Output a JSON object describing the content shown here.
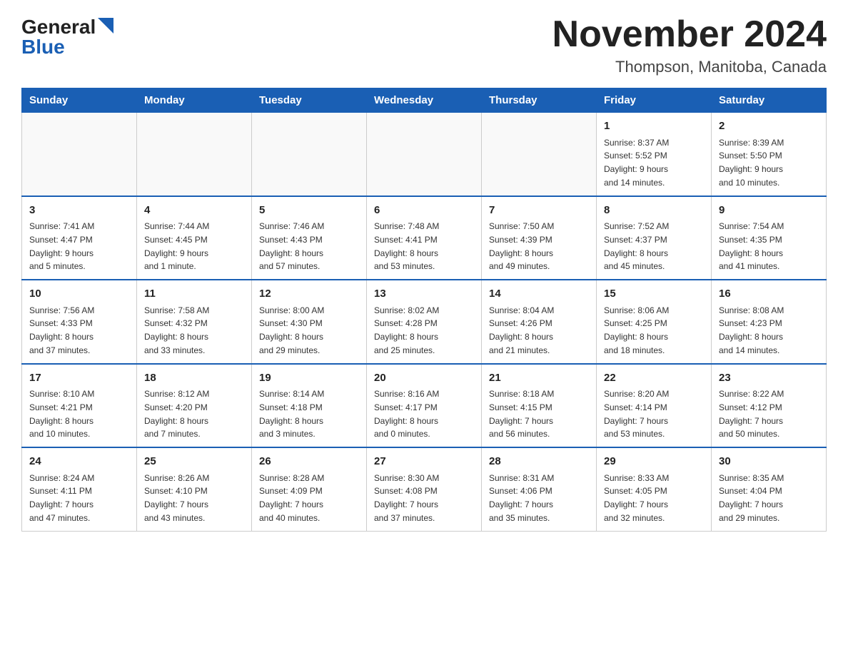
{
  "header": {
    "logo_general": "General",
    "logo_blue": "Blue",
    "title": "November 2024",
    "subtitle": "Thompson, Manitoba, Canada"
  },
  "days_of_week": [
    "Sunday",
    "Monday",
    "Tuesday",
    "Wednesday",
    "Thursday",
    "Friday",
    "Saturday"
  ],
  "weeks": [
    [
      {
        "day": "",
        "info": ""
      },
      {
        "day": "",
        "info": ""
      },
      {
        "day": "",
        "info": ""
      },
      {
        "day": "",
        "info": ""
      },
      {
        "day": "",
        "info": ""
      },
      {
        "day": "1",
        "info": "Sunrise: 8:37 AM\nSunset: 5:52 PM\nDaylight: 9 hours\nand 14 minutes."
      },
      {
        "day": "2",
        "info": "Sunrise: 8:39 AM\nSunset: 5:50 PM\nDaylight: 9 hours\nand 10 minutes."
      }
    ],
    [
      {
        "day": "3",
        "info": "Sunrise: 7:41 AM\nSunset: 4:47 PM\nDaylight: 9 hours\nand 5 minutes."
      },
      {
        "day": "4",
        "info": "Sunrise: 7:44 AM\nSunset: 4:45 PM\nDaylight: 9 hours\nand 1 minute."
      },
      {
        "day": "5",
        "info": "Sunrise: 7:46 AM\nSunset: 4:43 PM\nDaylight: 8 hours\nand 57 minutes."
      },
      {
        "day": "6",
        "info": "Sunrise: 7:48 AM\nSunset: 4:41 PM\nDaylight: 8 hours\nand 53 minutes."
      },
      {
        "day": "7",
        "info": "Sunrise: 7:50 AM\nSunset: 4:39 PM\nDaylight: 8 hours\nand 49 minutes."
      },
      {
        "day": "8",
        "info": "Sunrise: 7:52 AM\nSunset: 4:37 PM\nDaylight: 8 hours\nand 45 minutes."
      },
      {
        "day": "9",
        "info": "Sunrise: 7:54 AM\nSunset: 4:35 PM\nDaylight: 8 hours\nand 41 minutes."
      }
    ],
    [
      {
        "day": "10",
        "info": "Sunrise: 7:56 AM\nSunset: 4:33 PM\nDaylight: 8 hours\nand 37 minutes."
      },
      {
        "day": "11",
        "info": "Sunrise: 7:58 AM\nSunset: 4:32 PM\nDaylight: 8 hours\nand 33 minutes."
      },
      {
        "day": "12",
        "info": "Sunrise: 8:00 AM\nSunset: 4:30 PM\nDaylight: 8 hours\nand 29 minutes."
      },
      {
        "day": "13",
        "info": "Sunrise: 8:02 AM\nSunset: 4:28 PM\nDaylight: 8 hours\nand 25 minutes."
      },
      {
        "day": "14",
        "info": "Sunrise: 8:04 AM\nSunset: 4:26 PM\nDaylight: 8 hours\nand 21 minutes."
      },
      {
        "day": "15",
        "info": "Sunrise: 8:06 AM\nSunset: 4:25 PM\nDaylight: 8 hours\nand 18 minutes."
      },
      {
        "day": "16",
        "info": "Sunrise: 8:08 AM\nSunset: 4:23 PM\nDaylight: 8 hours\nand 14 minutes."
      }
    ],
    [
      {
        "day": "17",
        "info": "Sunrise: 8:10 AM\nSunset: 4:21 PM\nDaylight: 8 hours\nand 10 minutes."
      },
      {
        "day": "18",
        "info": "Sunrise: 8:12 AM\nSunset: 4:20 PM\nDaylight: 8 hours\nand 7 minutes."
      },
      {
        "day": "19",
        "info": "Sunrise: 8:14 AM\nSunset: 4:18 PM\nDaylight: 8 hours\nand 3 minutes."
      },
      {
        "day": "20",
        "info": "Sunrise: 8:16 AM\nSunset: 4:17 PM\nDaylight: 8 hours\nand 0 minutes."
      },
      {
        "day": "21",
        "info": "Sunrise: 8:18 AM\nSunset: 4:15 PM\nDaylight: 7 hours\nand 56 minutes."
      },
      {
        "day": "22",
        "info": "Sunrise: 8:20 AM\nSunset: 4:14 PM\nDaylight: 7 hours\nand 53 minutes."
      },
      {
        "day": "23",
        "info": "Sunrise: 8:22 AM\nSunset: 4:12 PM\nDaylight: 7 hours\nand 50 minutes."
      }
    ],
    [
      {
        "day": "24",
        "info": "Sunrise: 8:24 AM\nSunset: 4:11 PM\nDaylight: 7 hours\nand 47 minutes."
      },
      {
        "day": "25",
        "info": "Sunrise: 8:26 AM\nSunset: 4:10 PM\nDaylight: 7 hours\nand 43 minutes."
      },
      {
        "day": "26",
        "info": "Sunrise: 8:28 AM\nSunset: 4:09 PM\nDaylight: 7 hours\nand 40 minutes."
      },
      {
        "day": "27",
        "info": "Sunrise: 8:30 AM\nSunset: 4:08 PM\nDaylight: 7 hours\nand 37 minutes."
      },
      {
        "day": "28",
        "info": "Sunrise: 8:31 AM\nSunset: 4:06 PM\nDaylight: 7 hours\nand 35 minutes."
      },
      {
        "day": "29",
        "info": "Sunrise: 8:33 AM\nSunset: 4:05 PM\nDaylight: 7 hours\nand 32 minutes."
      },
      {
        "day": "30",
        "info": "Sunrise: 8:35 AM\nSunset: 4:04 PM\nDaylight: 7 hours\nand 29 minutes."
      }
    ]
  ]
}
